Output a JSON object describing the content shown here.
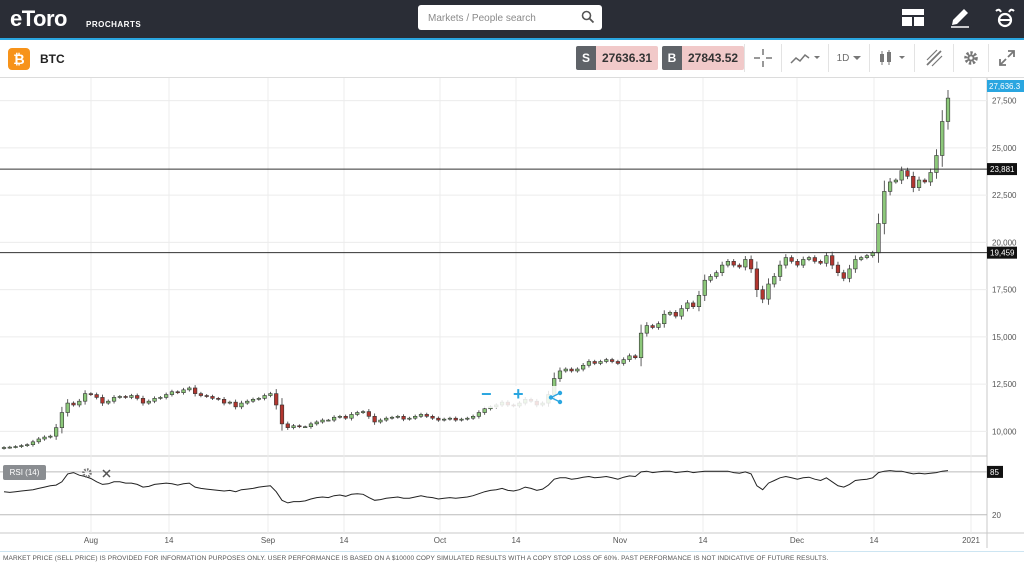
{
  "header": {
    "logo": "eToro",
    "logo_sub": "PROCHARTS",
    "search_placeholder": "Markets / People search",
    "icons": [
      "layout-icon",
      "edit-pencil-icon",
      "etoro-e-icon"
    ]
  },
  "instrument": {
    "symbol": "BTC",
    "sell_label": "S",
    "sell_price": "27636.31",
    "buy_label": "B",
    "buy_price": "27843.52",
    "interval": "1D",
    "tools": [
      "crosshair-icon",
      "chart-type-icon",
      "interval-dropdown",
      "indicators-icon",
      "drawing-icon",
      "settings-icon",
      "fullscreen-icon"
    ]
  },
  "chart_data": {
    "type": "candlestick",
    "x_ticks": [
      "Aug",
      "14",
      "Sep",
      "14",
      "Oct",
      "14",
      "Nov",
      "14",
      "Dec",
      "14",
      "2021"
    ],
    "y_ticks": [
      "27,500",
      "25,000",
      "22,500",
      "20,000",
      "17,500",
      "15,000",
      "12,500",
      "10,000"
    ],
    "ylim": [
      8700,
      28700
    ],
    "last_price_label": "27,636.3",
    "horizontal_lines": [
      {
        "label": "23,881",
        "value": 23881
      },
      {
        "label": "19,459",
        "value": 19459
      }
    ],
    "closes": [
      9150,
      9170,
      9200,
      9250,
      9300,
      9450,
      9600,
      9700,
      9750,
      10200,
      11000,
      11500,
      11400,
      11600,
      12000,
      11950,
      11800,
      11500,
      11600,
      11800,
      11850,
      11800,
      11900,
      11750,
      11500,
      11600,
      11750,
      11800,
      11950,
      12100,
      12050,
      12200,
      12300,
      12000,
      11900,
      11850,
      11750,
      11700,
      11500,
      11550,
      11300,
      11500,
      11600,
      11700,
      11750,
      11900,
      12000,
      11400,
      10400,
      10200,
      10300,
      10250,
      10250,
      10400,
      10500,
      10600,
      10600,
      10750,
      10800,
      10700,
      10900,
      11000,
      11050,
      10800,
      10500,
      10600,
      10700,
      10750,
      10800,
      10650,
      10700,
      10800,
      10900,
      10800,
      10700,
      10600,
      10650,
      10700,
      10600,
      10650,
      10700,
      10800,
      11000,
      11200,
      11300,
      11400,
      11550,
      11400,
      11350,
      11500,
      11700,
      11600,
      11400,
      11500,
      11950,
      12800,
      13200,
      13300,
      13200,
      13300,
      13500,
      13700,
      13600,
      13700,
      13800,
      13700,
      13600,
      13800,
      14000,
      13900,
      15200,
      15600,
      15500,
      15700,
      16200,
      16300,
      16100,
      16500,
      16800,
      16600,
      17200,
      18000,
      18200,
      18400,
      18800,
      19000,
      18800,
      18700,
      19100,
      18600,
      17500,
      17000,
      17800,
      18200,
      18800,
      19200,
      19000,
      18800,
      19100,
      19200,
      19000,
      18900,
      19300,
      18800,
      18400,
      18100,
      18600,
      19100,
      19200,
      19300,
      19450,
      21000,
      22700,
      23200,
      23300,
      23800,
      23500,
      22900,
      23300,
      23200,
      23700,
      24600,
      26400,
      27636
    ]
  },
  "rsi": {
    "label": "RSI (14)",
    "y_ticks": [
      "85",
      "20"
    ],
    "current_label": "85",
    "values": [
      55,
      54,
      55,
      56,
      57,
      58,
      60,
      62,
      64,
      65,
      70,
      82,
      84,
      80,
      78,
      75,
      70,
      66,
      67,
      70,
      70,
      68,
      68,
      66,
      62,
      63,
      66,
      67,
      68,
      67,
      65,
      67,
      68,
      62,
      60,
      59,
      58,
      57,
      56,
      57,
      55,
      58,
      59,
      60,
      62,
      63,
      64,
      55,
      42,
      38,
      40,
      40,
      41,
      44,
      46,
      47,
      46,
      49,
      50,
      48,
      51,
      52,
      51,
      46,
      42,
      43,
      45,
      46,
      47,
      45,
      45,
      47,
      49,
      47,
      46,
      44,
      45,
      46,
      45,
      46,
      47,
      49,
      52,
      55,
      57,
      58,
      60,
      57,
      56,
      58,
      62,
      60,
      57,
      59,
      65,
      74,
      76,
      76,
      74,
      75,
      77,
      78,
      76,
      77,
      78,
      76,
      74,
      77,
      79,
      78,
      85,
      86,
      84,
      85,
      86,
      86,
      84,
      85,
      86,
      84,
      85,
      86,
      86,
      86,
      86,
      86,
      84,
      83,
      85,
      82,
      64,
      58,
      68,
      72,
      76,
      78,
      76,
      74,
      76,
      77,
      74,
      72,
      76,
      70,
      64,
      62,
      66,
      72,
      73,
      74,
      76,
      84,
      86,
      87,
      86,
      86,
      84,
      82,
      83,
      82,
      83,
      84,
      86,
      87
    ]
  },
  "zoom_controls": [
    "zoom-out-icon",
    "zoom-in-icon",
    "share-icon"
  ],
  "footer_text": "MARKET PRICE (SELL PRICE) IS PROVIDED FOR INFORMATION PURPOSES ONLY. USER PERFORMANCE IS BASED ON A $10000 COPY SIMULATED RESULTS WITH A COPY STOP LOSS OF 60%. PAST PERFORMANCE IS NOT INDICATIVE OF FUTURE RESULTS.",
  "colors": {
    "topbar": "#2a2d36",
    "accent": "#2aa6e0",
    "bull": "#8cc87a",
    "bear": "#b3362f",
    "btc": "#f7931a"
  }
}
